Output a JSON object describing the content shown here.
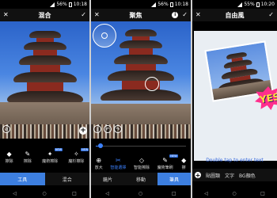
{
  "status": {
    "left_panel": {
      "battery": "56%",
      "time": "10:18"
    },
    "middle_panel": {
      "battery": "56%",
      "time": "10:18"
    },
    "right_panel": {
      "battery": "55%",
      "time": "10:20"
    }
  },
  "panel1": {
    "title": "混合",
    "tools": [
      {
        "label": "擦除",
        "icon": "eraser-icon",
        "badge": ""
      },
      {
        "label": "擦除",
        "icon": "brush-icon",
        "badge": ""
      },
      {
        "label": "魔術擦除",
        "icon": "magic-eraser-icon",
        "badge": "NEW"
      },
      {
        "label": "魔杉擦除",
        "icon": "magic-brush-icon",
        "badge": "NEW"
      }
    ],
    "tabs": [
      {
        "label": "工具",
        "selected": true
      },
      {
        "label": "混合",
        "selected": false
      }
    ]
  },
  "panel2": {
    "title": "聚焦",
    "tools": [
      {
        "label": "放大",
        "icon": "zoom-icon",
        "badge": "",
        "active": false
      },
      {
        "label": "智能選擇",
        "icon": "smart-select-icon",
        "badge": "",
        "active": true
      },
      {
        "label": "智能擦除",
        "icon": "smart-erase-icon",
        "badge": "",
        "active": false
      },
      {
        "label": "魔術筆刷",
        "icon": "magic-brush-icon",
        "badge": "NEW",
        "active": false
      },
      {
        "label": "擦",
        "icon": "eraser-icon",
        "badge": "",
        "active": false
      }
    ],
    "tabs": [
      {
        "label": "鏡片",
        "selected": false
      },
      {
        "label": "移動",
        "selected": false
      },
      {
        "label": "筆具",
        "selected": true
      }
    ],
    "slider_value": 0.05
  },
  "panel3": {
    "title": "自由風",
    "hint": "Double tap to enter text",
    "sticker_text": "YES",
    "bottom_items": [
      "貼圖類",
      "文字",
      "BG顏色"
    ]
  },
  "nav": {
    "back": "◁",
    "home": "○",
    "recent": "□"
  },
  "colors": {
    "accent": "#3d7fe0",
    "sticker": "#ff2f8c"
  }
}
